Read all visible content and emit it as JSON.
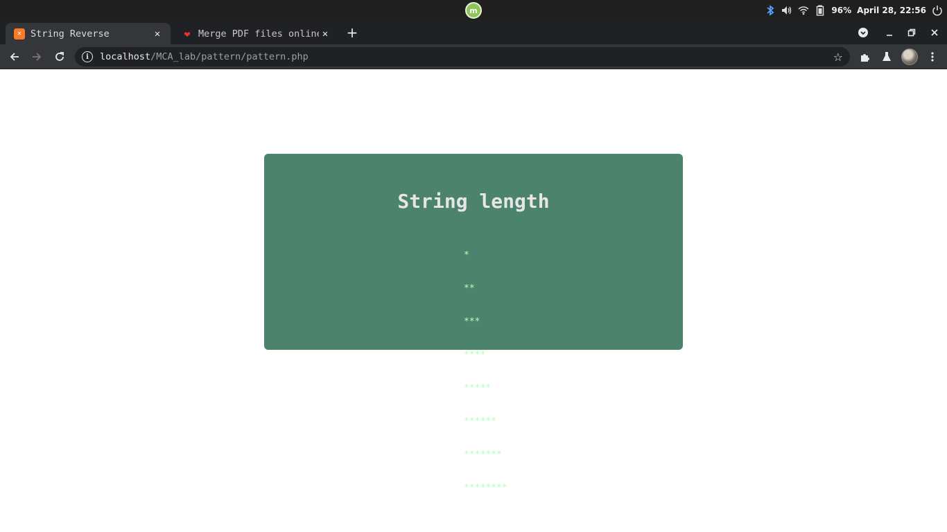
{
  "system": {
    "logo_label": "m",
    "battery": "96%",
    "datetime": "April 28, 22:56"
  },
  "browser": {
    "tabs": [
      {
        "title": "String Reverse",
        "active": true,
        "favicon": "xampp-icon"
      },
      {
        "title": "Merge PDF files online.",
        "active": false,
        "favicon": "heart-icon"
      }
    ],
    "url_host": "localhost",
    "url_path": "/MCA_lab/pattern/pattern.php"
  },
  "page": {
    "heading": "String length",
    "pattern_rows": [
      "*",
      "**",
      "***",
      "****",
      "*****",
      "******",
      "*******",
      "********"
    ]
  },
  "colors": {
    "card_bg": "#4b836d",
    "pattern_text": "#b6ffb4",
    "heading_text": "#e6e6e6"
  }
}
